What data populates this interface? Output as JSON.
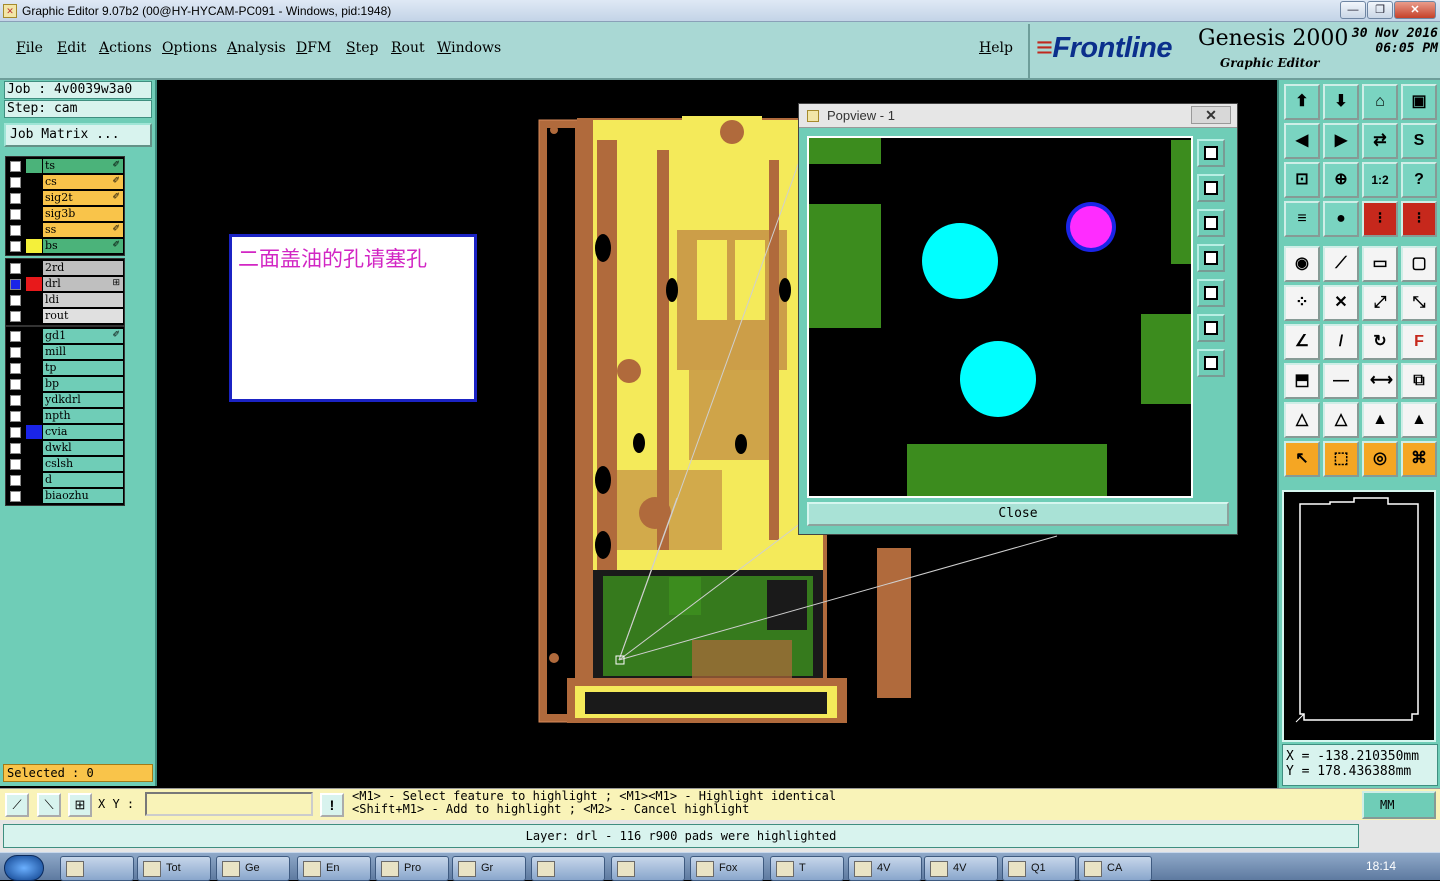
{
  "window": {
    "title": "Graphic Editor 9.07b2 (00@HY-HYCAM-PC091 - Windows, pid:1948)",
    "btn_min": "—",
    "btn_max": "❐",
    "btn_close": "✕"
  },
  "menu": {
    "items": [
      "File",
      "Edit",
      "Actions",
      "Options",
      "Analysis",
      "DFM",
      "Step",
      "Rout",
      "Windows"
    ],
    "help": "Help"
  },
  "brand": {
    "logo": "Frontline",
    "product": "Genesis 2000",
    "subtitle": "Graphic Editor",
    "date": "30 Nov 2016",
    "time": "06:05 PM"
  },
  "left": {
    "job": "Job : 4v0039w3a0",
    "step": "Step: cam",
    "job_matrix": "Job Matrix ...",
    "selected": "Selected : 0",
    "layer_groups": [
      [
        {
          "name": "ts",
          "bg": "#4bb37a",
          "swatch": "#4bb37a",
          "mark": "✐"
        },
        {
          "name": "cs",
          "bg": "#f9c44a",
          "swatch": "#000000",
          "mark": "✐"
        },
        {
          "name": "sig2t",
          "bg": "#f9c44a",
          "swatch": "#000000",
          "mark": "✐"
        },
        {
          "name": "sig3b",
          "bg": "#f9c44a",
          "swatch": "#000000",
          "mark": ""
        },
        {
          "name": "ss",
          "bg": "#f9c44a",
          "swatch": "#000000",
          "mark": "✐"
        },
        {
          "name": "bs",
          "bg": "#4bb37a",
          "swatch": "#f4f03a",
          "mark": "✐"
        }
      ],
      [
        {
          "name": "2rd",
          "bg": "#bfbfbf",
          "swatch": "#000000",
          "mark": ""
        },
        {
          "name": "drl",
          "bg": "#bfbfbf",
          "swatch": "#e8191b",
          "mark": "⊞"
        },
        {
          "name": "ldi",
          "bg": "#d0d0d0",
          "swatch": "#000000",
          "mark": ""
        },
        {
          "name": "rout",
          "bg": "#e0e0e0",
          "swatch": "#000000",
          "mark": ""
        }
      ],
      [
        {
          "name": "gd1",
          "bg": "#6fcdb7",
          "swatch": "#000000",
          "mark": "✐"
        },
        {
          "name": "mill",
          "bg": "#6fcdb7",
          "swatch": "#000000",
          "mark": ""
        },
        {
          "name": "tp",
          "bg": "#6fcdb7",
          "swatch": "#000000",
          "mark": ""
        },
        {
          "name": "bp",
          "bg": "#6fcdb7",
          "swatch": "#000000",
          "mark": ""
        },
        {
          "name": "ydkdrl",
          "bg": "#6fcdb7",
          "swatch": "#000000",
          "mark": ""
        },
        {
          "name": "npth",
          "bg": "#6fcdb7",
          "swatch": "#000000",
          "mark": ""
        },
        {
          "name": "cvia",
          "bg": "#6fcdb7",
          "swatch": "#1a24e8",
          "mark": ""
        },
        {
          "name": "dwkl",
          "bg": "#6fcdb7",
          "swatch": "#000000",
          "mark": ""
        },
        {
          "name": "cslsh",
          "bg": "#6fcdb7",
          "swatch": "#000000",
          "mark": ""
        },
        {
          "name": "d",
          "bg": "#6fcdb7",
          "swatch": "#000000",
          "mark": ""
        },
        {
          "name": "biaozhu",
          "bg": "#6fcdb7",
          "swatch": "#000000",
          "mark": ""
        }
      ]
    ]
  },
  "canvas": {
    "note_text": "二面盖油的孔请塞孔"
  },
  "popview": {
    "title": "Popview - 1",
    "close_x": "✕",
    "close_button": "Close"
  },
  "coords": {
    "x": "X = -138.210350mm",
    "y": "Y = 178.436388mm"
  },
  "cmdbar": {
    "xy_label": "X Y :",
    "xy_value": "",
    "warn": "!",
    "help_line1": "<M1> - Select feature to highlight ; <M1><M1> - Highlight identical",
    "help_line2": "<Shift+M1> - Add to highlight ; <M2> - Cancel highlight",
    "unit": "MM"
  },
  "status": {
    "message": "Layer: drl - 116 r900 pads were highlighted"
  },
  "taskbar": {
    "tasks": [
      "  ",
      "Tot",
      "Ge",
      "En",
      "Pro",
      "Gr",
      "",
      "",
      "Fox",
      "T",
      "4V",
      "4V",
      "Q1",
      "CA"
    ],
    "clock": "18:14"
  },
  "colors": {
    "teal": "#6fcdb7",
    "menu_bg": "#a9d8d4",
    "board_copper": "#b06a3c",
    "board_yellow": "#f4ea5a",
    "board_green": "#3c8c1e",
    "cyan_pad": "#00ffff",
    "magenta_pad": "#ff2cff"
  }
}
